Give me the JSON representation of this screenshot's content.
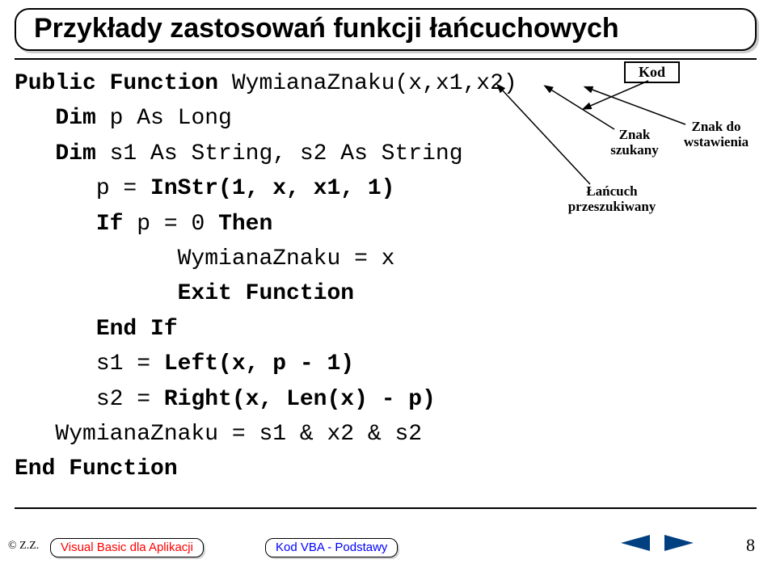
{
  "title": "Przykłady zastosowań funkcji łańcuchowych",
  "kod_label": "Kod",
  "annotations": {
    "znak_do_wstawienia_l1": "Znak do",
    "znak_do_wstawienia_l2": "wstawienia",
    "znak_szukany_l1": "Znak",
    "znak_szukany_l2": "szukany",
    "lancuch_l1": "Łańcuch",
    "lancuch_l2": "przeszukiwany"
  },
  "code": {
    "l1a": "Public Function ",
    "l1b": "WymianaZnaku(x,x1,x2)",
    "l2a": "   Dim ",
    "l2b": "p As Long",
    "l3a": "   Dim ",
    "l3b": "s1 As String, s2 As String",
    "l4a": "      p = ",
    "l4b": "InStr(1, x, x1, 1)",
    "l5a": "      If ",
    "l5b": "p = 0 ",
    "l5c": "Then",
    "l6": "            WymianaZnaku = x",
    "l7a": "            Exit Function",
    "l8a": "      End If",
    "l9": "      s1 = ",
    "l9b": "Left(x, p - 1)",
    "l10": "      s2 = ",
    "l10b": "Right(x, Len(x) - p)",
    "l11": "   WymianaZnaku = s1 & x2 & s2",
    "l12": "End Function"
  },
  "footer": {
    "copyright": "© Z.Z.",
    "pill1": "Visual Basic dla Aplikacji",
    "pill2": "Kod VBA - Podstawy",
    "page": "8"
  }
}
